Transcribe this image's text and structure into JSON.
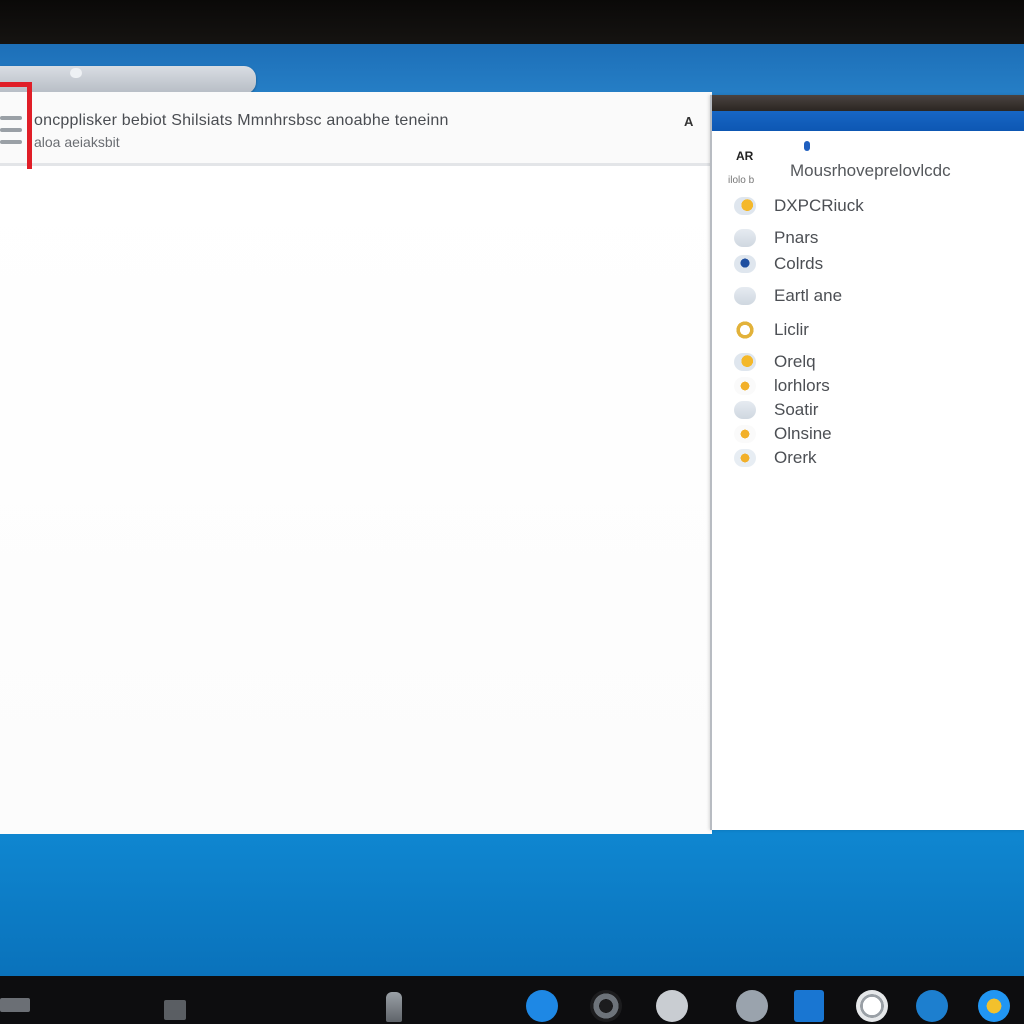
{
  "main_window": {
    "header_line1": "oncpplisker bebiot Shilsiats Mmnhrsbsc anoabhe teneinn",
    "header_line2": "aloa aeiaksbit",
    "header_corner": "A"
  },
  "side_panel": {
    "ar_label": "AR",
    "sub_label": "ilolo b",
    "heading": "Mousrhoveprelovlcdc",
    "items": [
      {
        "label": "DXPCRiuck",
        "icon": "sun-cloud-icon"
      },
      {
        "label": "Pnars",
        "icon": "cloud-icon"
      },
      {
        "label": "Colrds",
        "icon": "pin-icon"
      },
      {
        "label": "Eartl ane",
        "icon": "cloud-icon"
      },
      {
        "label": "Liclir",
        "icon": "ring-icon"
      },
      {
        "label": "Orelq",
        "icon": "sun-cloud-icon"
      },
      {
        "label": "lorhlors",
        "icon": "sun-icon"
      },
      {
        "label": "Soatir",
        "icon": "cloud-icon"
      },
      {
        "label": "Olnsine",
        "icon": "sun-icon"
      },
      {
        "label": "Orerk",
        "icon": "sun-badge-icon"
      }
    ]
  },
  "taskbar": {
    "items": [
      {
        "name": "start",
        "color": "#6b6f75"
      },
      {
        "name": "file-explorer",
        "color": "#5a5e63"
      },
      {
        "name": "app-bottle",
        "color": "#8a9096"
      },
      {
        "name": "edge-browser",
        "color": "#1e88e5"
      },
      {
        "name": "camera-app",
        "color": "#6d737a"
      },
      {
        "name": "app-figure",
        "color": "#c9cdd2"
      },
      {
        "name": "app-person",
        "color": "#9aa3ad"
      },
      {
        "name": "security-app",
        "color": "#1976d2"
      },
      {
        "name": "app-circle",
        "color": "#e6e8ea"
      },
      {
        "name": "app-globe",
        "color": "#1d7fcf"
      },
      {
        "name": "weather-app",
        "color": "#2196f3"
      }
    ]
  },
  "colors": {
    "desktop_blue": "#1f7fc6",
    "highlight_red": "#e01e27",
    "panel_accent": "#1766c4"
  }
}
